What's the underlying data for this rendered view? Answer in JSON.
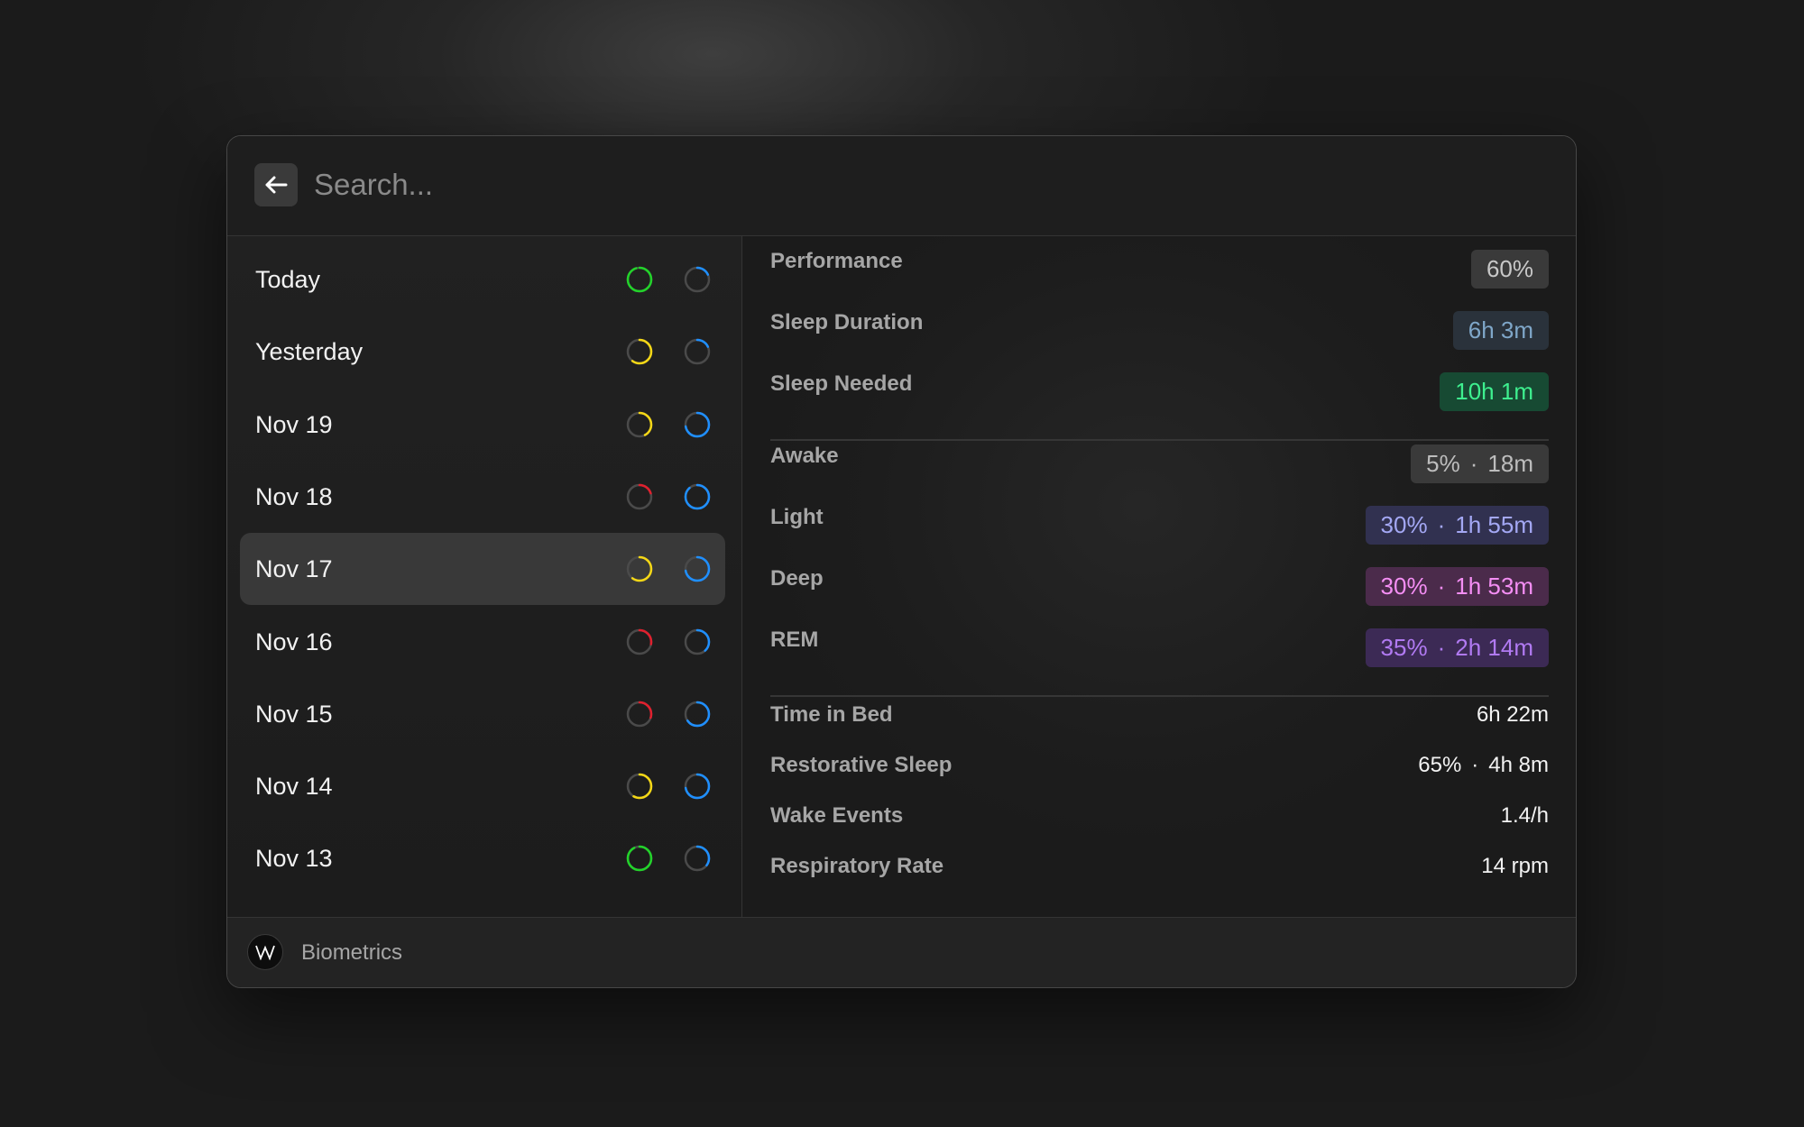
{
  "search": {
    "placeholder": "Search..."
  },
  "icons": {
    "back": "arrow-left-icon",
    "app": "whoop-logo-icon"
  },
  "colors": {
    "green": "#22d32a",
    "yellow": "#f4d716",
    "red": "#e0202e",
    "blue": "#1f8fff",
    "track": "#4a4a4a"
  },
  "sidebar": {
    "items": [
      {
        "label": "Today",
        "selected": false,
        "ring1": {
          "color": "green",
          "fraction": 0.95
        },
        "ring2": {
          "color": "blue",
          "fraction": 0.18
        }
      },
      {
        "label": "Yesterday",
        "selected": false,
        "ring1": {
          "color": "yellow",
          "fraction": 0.6
        },
        "ring2": {
          "color": "blue",
          "fraction": 0.18
        }
      },
      {
        "label": "Nov 19",
        "selected": false,
        "ring1": {
          "color": "yellow",
          "fraction": 0.42
        },
        "ring2": {
          "color": "blue",
          "fraction": 0.72
        }
      },
      {
        "label": "Nov 18",
        "selected": false,
        "ring1": {
          "color": "red",
          "fraction": 0.2
        },
        "ring2": {
          "color": "blue",
          "fraction": 0.88
        }
      },
      {
        "label": "Nov 17",
        "selected": true,
        "ring1": {
          "color": "yellow",
          "fraction": 0.6
        },
        "ring2": {
          "color": "blue",
          "fraction": 0.72
        }
      },
      {
        "label": "Nov 16",
        "selected": false,
        "ring1": {
          "color": "red",
          "fraction": 0.28
        },
        "ring2": {
          "color": "blue",
          "fraction": 0.38
        }
      },
      {
        "label": "Nov 15",
        "selected": false,
        "ring1": {
          "color": "red",
          "fraction": 0.3
        },
        "ring2": {
          "color": "blue",
          "fraction": 0.65
        }
      },
      {
        "label": "Nov 14",
        "selected": false,
        "ring1": {
          "color": "yellow",
          "fraction": 0.58
        },
        "ring2": {
          "color": "blue",
          "fraction": 0.72
        }
      },
      {
        "label": "Nov 13",
        "selected": false,
        "ring1": {
          "color": "green",
          "fraction": 0.92
        },
        "ring2": {
          "color": "blue",
          "fraction": 0.35
        }
      }
    ]
  },
  "details": {
    "performance": {
      "label": "Performance",
      "value": "60%",
      "bg": "#3a3a3a",
      "fg": "#c8c8c8"
    },
    "sleep_duration": {
      "label": "Sleep Duration",
      "value": "6h 3m",
      "bg": "#2a323b",
      "fg": "#7fa7c9"
    },
    "sleep_needed": {
      "label": "Sleep Needed",
      "value": "10h 1m",
      "bg": "#174a33",
      "fg": "#3ef08f"
    },
    "awake": {
      "label": "Awake",
      "pct": "5%",
      "sep": "·",
      "dur": "18m",
      "bg": "#3a3a3a",
      "fg": "#bdbdbd"
    },
    "light": {
      "label": "Light",
      "pct": "30%",
      "sep": "·",
      "dur": "1h 55m",
      "bg": "#313150",
      "fg": "#a4a8f4"
    },
    "deep": {
      "label": "Deep",
      "pct": "30%",
      "sep": "·",
      "dur": "1h 53m",
      "bg": "#4b2b4b",
      "fg": "#f48ef4"
    },
    "rem": {
      "label": "REM",
      "pct": "35%",
      "sep": "·",
      "dur": "2h 14m",
      "bg": "#3c2a55",
      "fg": "#b17af2"
    },
    "time_in_bed": {
      "label": "Time in Bed",
      "value": "6h 22m"
    },
    "restorative": {
      "label": "Restorative Sleep",
      "pct": "65%",
      "sep": "·",
      "dur": "4h 8m"
    },
    "wake_events": {
      "label": "Wake Events",
      "value": "1.4/h"
    },
    "respiratory": {
      "label": "Respiratory Rate",
      "value": "14 rpm"
    }
  },
  "footer": {
    "label": "Biometrics"
  }
}
